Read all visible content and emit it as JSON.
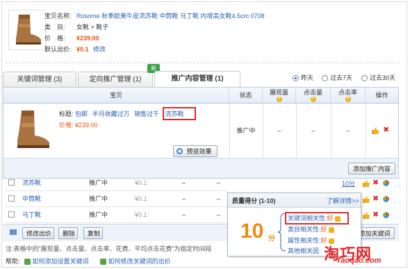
{
  "product": {
    "name_label": "宝贝名称:",
    "name": "Rosome 秋季欧美牛皮流苏靴 中筒靴 马丁靴 内增高女靴4.5cm 0708",
    "category_label": "类　目:",
    "category": "女靴 > 靴子",
    "price_label": "价　格:",
    "price": "¥239.00",
    "bid_label": "默认出价:",
    "bid": "¥0.1",
    "bid_edit": "修改"
  },
  "tabs": [
    {
      "label": "关键词管理 (3)"
    },
    {
      "label": "定向推广管理 (1)"
    },
    {
      "label": "推广内容管理 (1)"
    }
  ],
  "new_badge": "新",
  "range": {
    "options": [
      "昨天",
      "过去7天",
      "过去30天"
    ],
    "selected": "昨天"
  },
  "table": {
    "headers": [
      "宝贝",
      "状态",
      "展现量",
      "点击量",
      "点击率",
      "操作"
    ],
    "row": {
      "title_label": "标题:",
      "title_parts": [
        "包邮",
        "半月收藏过万",
        "销售过千",
        "流苏靴"
      ],
      "price_label": "价格:",
      "price": "¥239.00",
      "preview_button": "预览效果",
      "status": "推广中",
      "impressions": "–",
      "clicks": "–",
      "ctr": "–"
    },
    "add_content_button": "添加推广内容"
  },
  "keywords": {
    "rows": [
      {
        "keyword": "流苏靴",
        "status": "推广中",
        "bid": "¥0.1",
        "imp": "–",
        "clicks": "–"
      },
      {
        "keyword": "中筒靴",
        "status": "推广中",
        "bid": "¥0.1",
        "imp": "–",
        "clicks": "–"
      },
      {
        "keyword": "马丁靴",
        "status": "推广中",
        "bid": "¥0.1",
        "imp": "–",
        "clicks": "–"
      }
    ],
    "quality_link": "10分",
    "buttons": {
      "edit_bid": "修改出价",
      "delete": "删除",
      "copy": "复制",
      "add_keyword": "添加关键词"
    }
  },
  "quality_popup": {
    "title": "质量得分 (1-10)",
    "detail_link": "了解详情>>",
    "score": "10",
    "unit": "分",
    "items": [
      {
        "label": "关键词相关性:",
        "value": "好"
      },
      {
        "label": "类目相关性:",
        "value": "好"
      },
      {
        "label": "属性相关性:",
        "value": "好"
      },
      {
        "label": "其他相关因",
        "value": ""
      }
    ]
  },
  "note": "注:表格中的“展现量、点击量、点击率、花费、平均点击花费”为指定时间段",
  "help": {
    "label": "帮助:",
    "links": [
      "如何添加设置关键词",
      "如何修改关键词的出价"
    ]
  },
  "watermark": {
    "text": "淘巧网",
    "sub": "Taoqao.com"
  }
}
